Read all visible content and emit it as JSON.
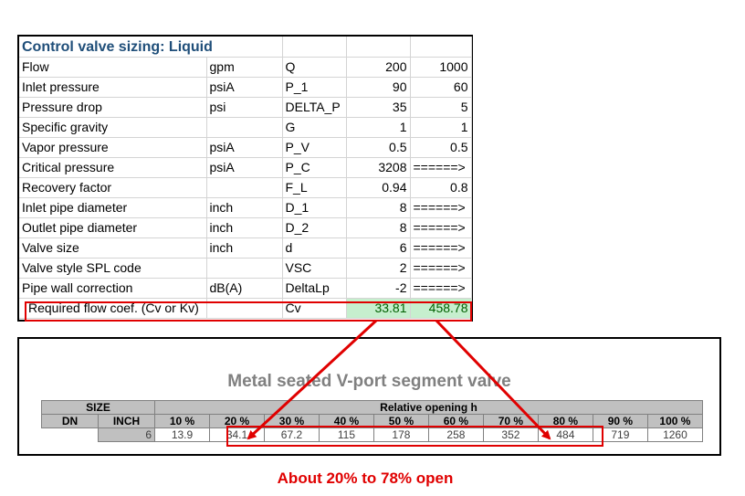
{
  "sheet": {
    "title": "Control valve sizing: Liquid",
    "rows": [
      {
        "label": "Flow",
        "unit": "gpm",
        "symbol": "Q",
        "v1": "200",
        "v2": "1000"
      },
      {
        "label": "Inlet pressure",
        "unit": "psiA",
        "symbol": "P_1",
        "v1": "90",
        "v2": "60"
      },
      {
        "label": "Pressure drop",
        "unit": "psi",
        "symbol": "DELTA_P",
        "v1": "35",
        "v2": "5"
      },
      {
        "label": "Specific gravity",
        "unit": "",
        "symbol": "G",
        "v1": "1",
        "v2": "1"
      },
      {
        "label": "Vapor pressure",
        "unit": "psiA",
        "symbol": "P_V",
        "v1": "0.5",
        "v2": "0.5"
      },
      {
        "label": "Critical pressure",
        "unit": "psiA",
        "symbol": "P_C",
        "v1": "3208",
        "v2": "======>"
      },
      {
        "label": "Recovery factor",
        "unit": "",
        "symbol": "F_L",
        "v1": "0.94",
        "v2": "0.8"
      },
      {
        "label": "Inlet pipe diameter",
        "unit": "inch",
        "symbol": "D_1",
        "v1": "8",
        "v2": "======>"
      },
      {
        "label": "Outlet pipe diameter",
        "unit": "inch",
        "symbol": "D_2",
        "v1": "8",
        "v2": "======>"
      },
      {
        "label": "Valve size",
        "unit": "inch",
        "symbol": "d",
        "v1": "6",
        "v2": "======>"
      },
      {
        "label": "Valve style SPL code",
        "unit": "",
        "symbol": "VSC",
        "v1": "2",
        "v2": "======>"
      },
      {
        "label": "Pipe wall correction",
        "unit": "dB(A)",
        "symbol": "DeltaLp",
        "v1": "-2",
        "v2": "======>"
      }
    ],
    "result": {
      "label": "Required flow coef. (Cv or Kv)",
      "unit": "",
      "symbol": "Cv",
      "v1": "33.81",
      "v2": "458.78"
    }
  },
  "valve": {
    "title": "Metal seated V-port segment valve",
    "size_header": "SIZE",
    "opening_header": "Relative opening h",
    "dn_header": "DN",
    "inch_header": "INCH",
    "openings": [
      "10 %",
      "20 %",
      "30 %",
      "40 %",
      "50 %",
      "60 %",
      "70 %",
      "80 %",
      "90 %",
      "100 %"
    ],
    "dn_value": "",
    "inch_value": "6",
    "cv_values": [
      "13.9",
      "34.1",
      "67.2",
      "115",
      "178",
      "258",
      "352",
      "484",
      "719",
      "1260"
    ]
  },
  "caption": "About 20% to 78% open",
  "colors": {
    "highlight": "#e00000",
    "title_blue": "#1f4e79",
    "result_green": "#c6efce"
  }
}
